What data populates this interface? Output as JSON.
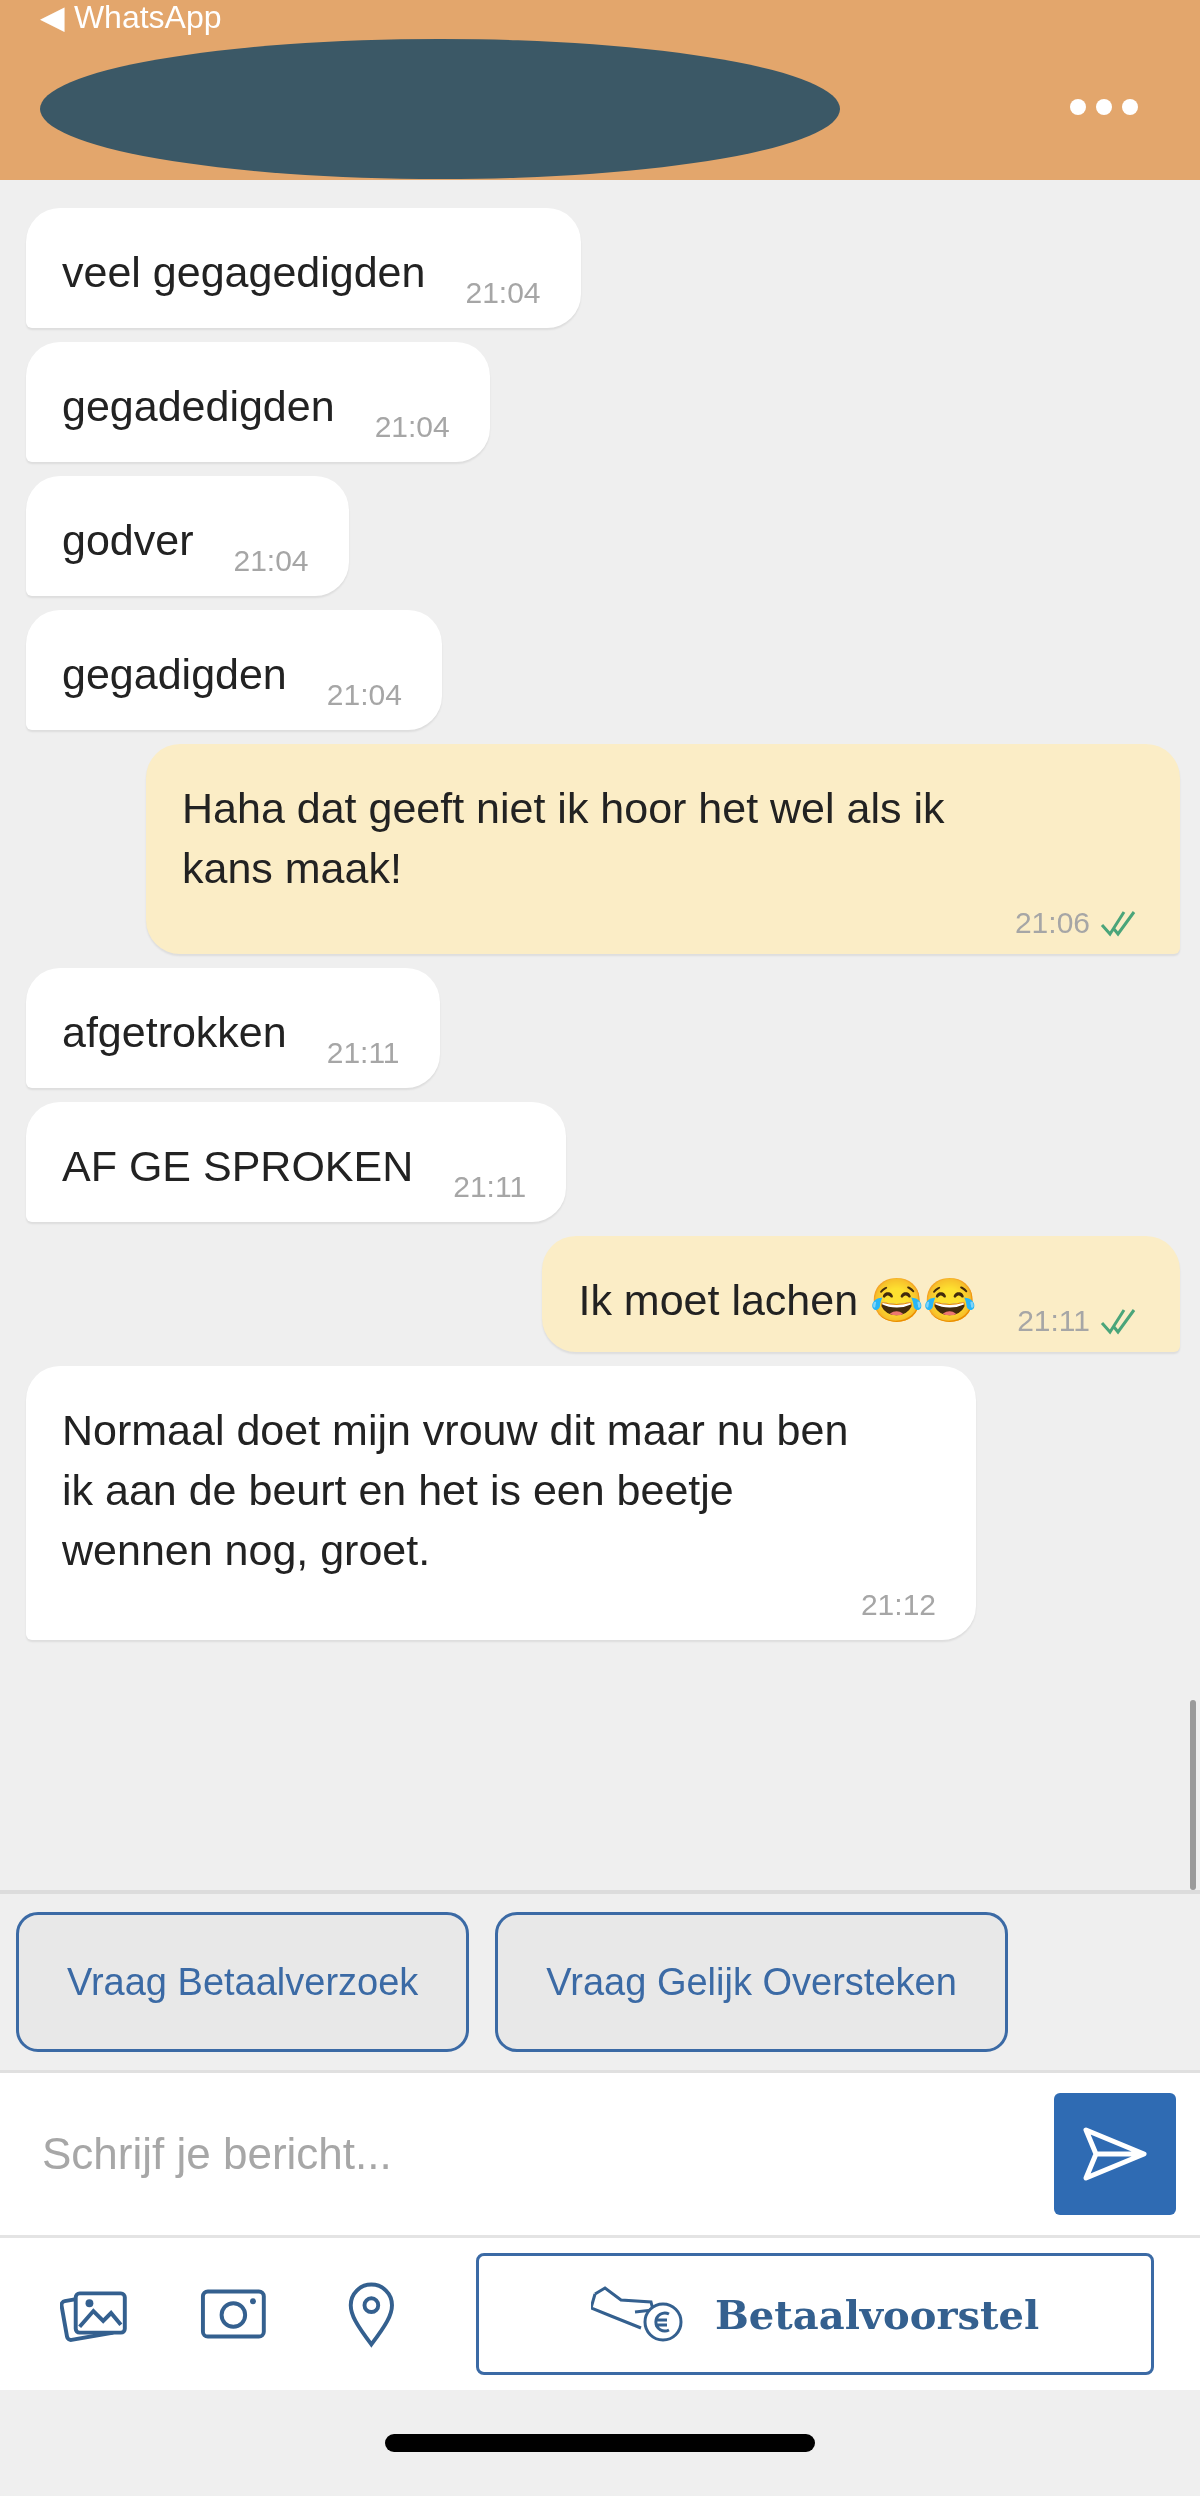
{
  "status_bar": {
    "back_label": "◀ WhatsApp"
  },
  "header": {
    "name_redacted": true
  },
  "messages": [
    {
      "kind": "incoming",
      "text": "veel gegagedigden",
      "time": "21:04"
    },
    {
      "kind": "incoming",
      "text": "gegadedigden",
      "time": "21:04"
    },
    {
      "kind": "incoming",
      "text": "godver",
      "time": "21:04"
    },
    {
      "kind": "incoming",
      "text": "gegadigden",
      "time": "21:04"
    },
    {
      "kind": "outgoing",
      "text": "Haha dat geeft niet ik hoor het wel als ik kans maak!",
      "time": "21:06",
      "read": true
    },
    {
      "kind": "incoming",
      "text": "afgetrokken",
      "time": "21:11"
    },
    {
      "kind": "incoming",
      "text": "AF GE SPROKEN",
      "time": "21:11"
    },
    {
      "kind": "outgoing",
      "text": "Ik moet lachen 😂😂",
      "time": "21:11",
      "read": true
    },
    {
      "kind": "incoming",
      "text": "Normaal doet mijn vrouw dit maar nu ben ik aan de beurt en het is een beetje wennen nog, groet.",
      "time": "21:12"
    }
  ],
  "quick_actions": [
    "Vraag Betaalverzoek",
    "Vraag Gelijk Oversteken"
  ],
  "composer": {
    "placeholder": "Schrijf je bericht..."
  },
  "toolbar": {
    "payment_button": "Betaalvoorstel"
  }
}
